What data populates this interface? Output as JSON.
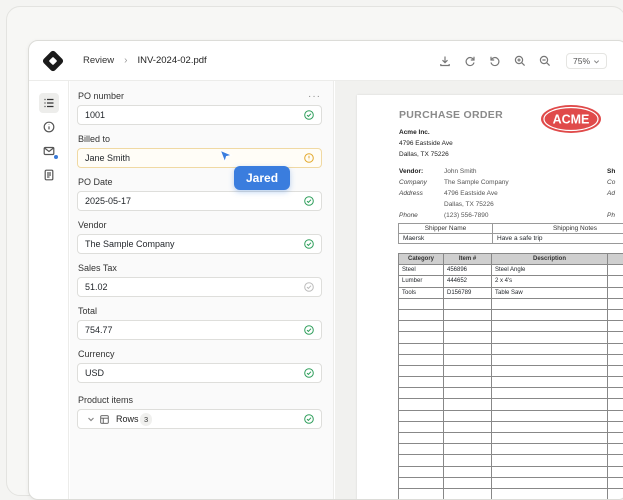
{
  "header": {
    "crumb_root": "Review",
    "file_name": "INV-2024-02.pdf",
    "zoom": "75%"
  },
  "form": {
    "fields": [
      {
        "label": "PO number",
        "value": "1001",
        "status": "ok"
      },
      {
        "label": "Billed to",
        "value": "Jane Smith",
        "status": "warn"
      },
      {
        "label": "PO Date",
        "value": "2025-05-17",
        "status": "ok"
      },
      {
        "label": "Vendor",
        "value": "The Sample Company",
        "status": "ok"
      },
      {
        "label": "Sales Tax",
        "value": "51.02",
        "status": "muted"
      },
      {
        "label": "Total",
        "value": "754.77",
        "status": "ok"
      },
      {
        "label": "Currency",
        "value": "USD",
        "status": "ok"
      }
    ],
    "more_label": "···",
    "product_items_label": "Product items",
    "rows_label": "Rows",
    "rows_count": "3"
  },
  "collaborator": {
    "name": "Jared",
    "color": "#3a7dde"
  },
  "colors": {
    "ok": "#2e9e5b",
    "warn": "#e3a92d",
    "muted": "#bcbcbc",
    "accent": "#3a7dde",
    "acme_red": "#e04a4a"
  },
  "document": {
    "title": "PURCHASE ORDER",
    "logo_text": "ACME",
    "company": "Acme Inc.",
    "address1": "4796 Eastside Ave",
    "address2": "Dallas, TX  75226",
    "vendor_label": "Vendor:",
    "vendor_name": "John Smith",
    "company_label": "Company",
    "company_value": "The Sample Company",
    "address_label": "Address",
    "address_value1": "4796 Eastside Ave",
    "address_value2": "Dallas, TX  75226",
    "phone_label": "Phone",
    "phone_value": "(123) 556-7890",
    "right_col_1": "Sh",
    "right_col_2": "Co",
    "right_col_3": "Ad",
    "right_col_4": "Ph",
    "shipper_header": "Shipper Name",
    "notes_header": "Shipping Notes",
    "shipper_value": "Maersk",
    "notes_value": "Have a safe trip",
    "items_headers": [
      "Category",
      "Item #",
      "Description",
      ""
    ],
    "items": [
      [
        "Steel",
        "456896",
        "Steel Angle",
        ""
      ],
      [
        "Lumber",
        "444652",
        "2 x 4's",
        ""
      ],
      [
        "Tools",
        "D156789",
        "Table Saw",
        ""
      ]
    ]
  },
  "icons": {
    "rail": [
      "list-icon",
      "info-icon",
      "mail-icon",
      "document-icon"
    ],
    "toolbar": [
      "download-icon",
      "redo-icon",
      "undo-icon",
      "zoom-in-icon",
      "zoom-out-icon"
    ]
  }
}
